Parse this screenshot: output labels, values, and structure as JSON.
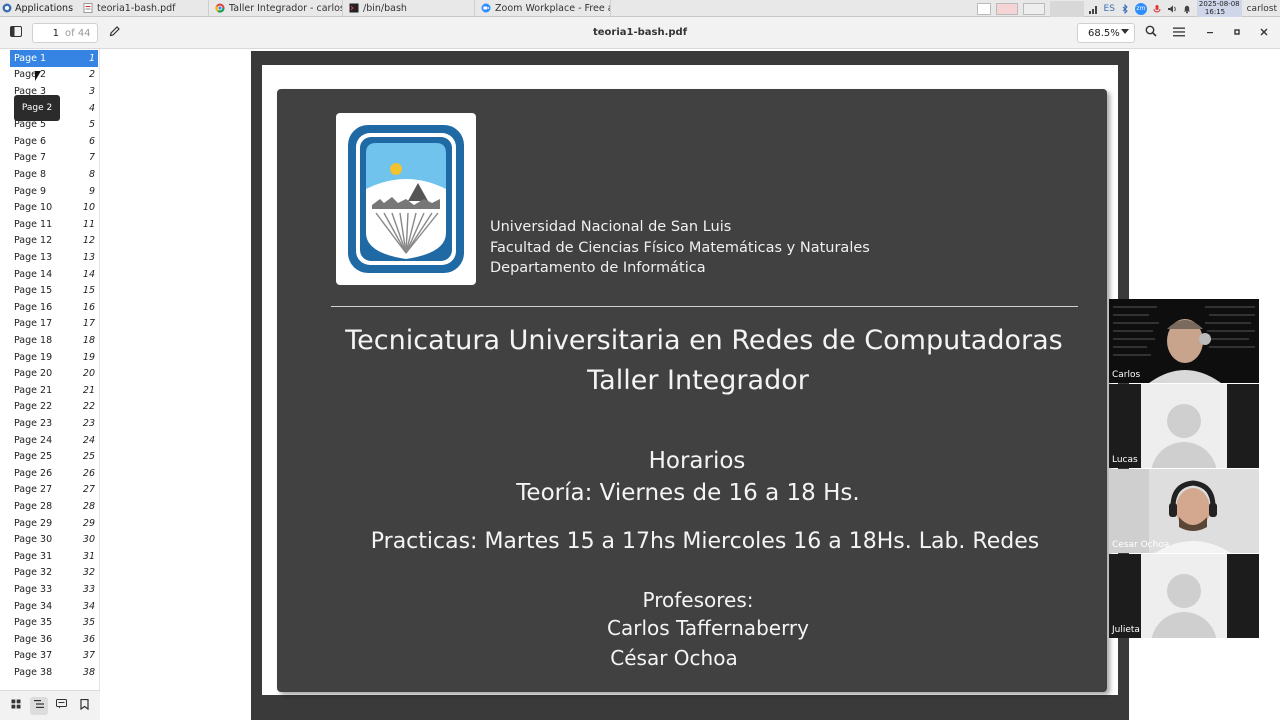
{
  "taskbar": {
    "applications_label": "Applications",
    "tabs": [
      {
        "label": "teoria1-bash.pdf",
        "icon": "pdf-icon"
      },
      {
        "label": "Taller Integrador - carlos.t...",
        "icon": "chrome-icon"
      },
      {
        "label": "/bin/bash",
        "icon": "terminal-icon"
      },
      {
        "label": "Zoom Workplace - Free ac...",
        "icon": "zoom-icon"
      }
    ],
    "keyboard_layout": "ES",
    "date": "2025-08-08",
    "time": "16:15",
    "user": "carlost"
  },
  "toolbar": {
    "current_page": "1",
    "page_count_label": "of 44",
    "document_title": "teoria1-bash.pdf",
    "zoom_level": "68.5%"
  },
  "sidebar": {
    "tooltip": "Page 2",
    "items": [
      {
        "label": "Page 1",
        "num": "1"
      },
      {
        "label": "Page 2",
        "num": "2"
      },
      {
        "label": "Page 3",
        "num": "3"
      },
      {
        "label": "Page 4",
        "num": "4"
      },
      {
        "label": "Page 5",
        "num": "5"
      },
      {
        "label": "Page 6",
        "num": "6"
      },
      {
        "label": "Page 7",
        "num": "7"
      },
      {
        "label": "Page 8",
        "num": "8"
      },
      {
        "label": "Page 9",
        "num": "9"
      },
      {
        "label": "Page 10",
        "num": "10"
      },
      {
        "label": "Page 11",
        "num": "11"
      },
      {
        "label": "Page 12",
        "num": "12"
      },
      {
        "label": "Page 13",
        "num": "13"
      },
      {
        "label": "Page 14",
        "num": "14"
      },
      {
        "label": "Page 15",
        "num": "15"
      },
      {
        "label": "Page 16",
        "num": "16"
      },
      {
        "label": "Page 17",
        "num": "17"
      },
      {
        "label": "Page 18",
        "num": "18"
      },
      {
        "label": "Page 19",
        "num": "19"
      },
      {
        "label": "Page 20",
        "num": "20"
      },
      {
        "label": "Page 21",
        "num": "21"
      },
      {
        "label": "Page 22",
        "num": "22"
      },
      {
        "label": "Page 23",
        "num": "23"
      },
      {
        "label": "Page 24",
        "num": "24"
      },
      {
        "label": "Page 25",
        "num": "25"
      },
      {
        "label": "Page 26",
        "num": "26"
      },
      {
        "label": "Page 27",
        "num": "27"
      },
      {
        "label": "Page 28",
        "num": "28"
      },
      {
        "label": "Page 29",
        "num": "29"
      },
      {
        "label": "Page 30",
        "num": "30"
      },
      {
        "label": "Page 31",
        "num": "31"
      },
      {
        "label": "Page 32",
        "num": "32"
      },
      {
        "label": "Page 33",
        "num": "33"
      },
      {
        "label": "Page 34",
        "num": "34"
      },
      {
        "label": "Page 35",
        "num": "35"
      },
      {
        "label": "Page 36",
        "num": "36"
      },
      {
        "label": "Page 37",
        "num": "37"
      },
      {
        "label": "Page 38",
        "num": "38"
      }
    ]
  },
  "slide": {
    "university_lines": [
      "Universidad Nacional de San Luis",
      "Facultad de Ciencias Físico Matemáticas y Naturales",
      "Departamento de Informática"
    ],
    "title_line1": "Tecnicatura Universitaria en Redes de Computadoras",
    "title_line2": "Taller Integrador",
    "schedule_heading": "Horarios",
    "theory": "Teoría: Viernes de 16 a 18 Hs.",
    "practice": "Practicas: Martes 15 a 17hs Miercoles 16 a 18Hs. Lab. Redes",
    "professors_heading": "Profesores:",
    "professor_1": "Carlos Taffernaberry",
    "professor_2": "César Ochoa"
  },
  "participants": [
    {
      "name": "Carlos",
      "video": true
    },
    {
      "name": "Lucas",
      "video": false
    },
    {
      "name": "Cesar Ochoa",
      "video": true
    },
    {
      "name": "Julieta",
      "video": false
    }
  ],
  "colors": {
    "accent": "#3584e4",
    "slide_background": "#414141",
    "logo_blue": "#1f6aa5",
    "logo_sky": "#6fc3ec",
    "logo_sun": "#f2c230"
  }
}
